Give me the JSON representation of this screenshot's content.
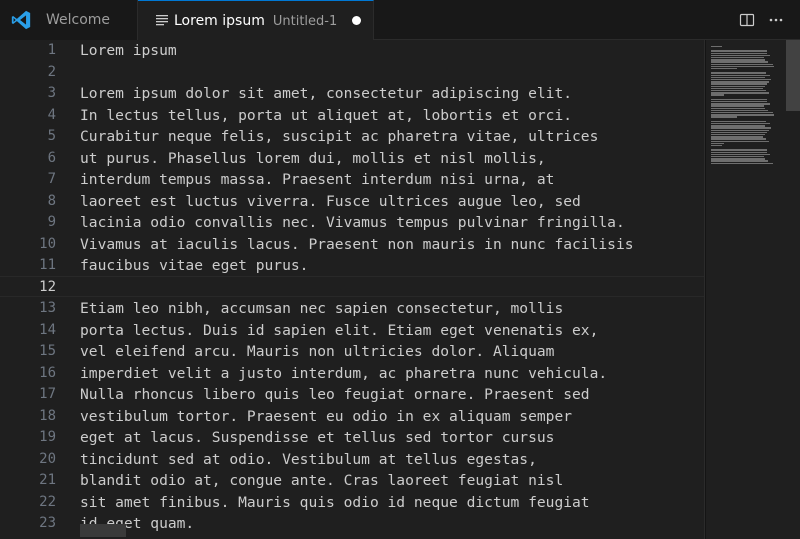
{
  "tabs": [
    {
      "label": "Welcome"
    },
    {
      "label": "Lorem ipsum",
      "description": "Untitled-1",
      "dirty": true
    }
  ],
  "editor": {
    "active_line": 12,
    "lines": [
      "Lorem ipsum",
      "",
      "Lorem ipsum dolor sit amet, consectetur adipiscing elit.",
      "In lectus tellus, porta ut aliquet at, lobortis et orci.",
      "Curabitur neque felis, suscipit ac pharetra vitae, ultrices",
      "ut purus. Phasellus lorem dui, mollis et nisl mollis,",
      "interdum tempus massa. Praesent interdum nisi urna, at",
      "laoreet est luctus viverra. Fusce ultrices augue leo, sed",
      "lacinia odio convallis nec. Vivamus tempus pulvinar fringilla.",
      "Vivamus at iaculis lacus. Praesent non mauris in nunc facilisis",
      "faucibus vitae eget purus.",
      "",
      "Etiam leo nibh, accumsan nec sapien consectetur, mollis",
      "porta lectus. Duis id sapien elit. Etiam eget venenatis ex,",
      "vel eleifend arcu. Mauris non ultricies dolor. Aliquam",
      "imperdiet velit a justo interdum, ac pharetra nunc vehicula.",
      "Nulla rhoncus libero quis leo feugiat ornare. Praesent sed",
      "vestibulum tortor. Praesent eu odio in ex aliquam semper",
      "eget at lacus. Suspendisse et tellus sed tortor cursus",
      "tincidunt sed at odio. Vestibulum at tellus egestas,",
      "blandit odio at, congue ante. Cras laoreet feugiat nisl",
      "sit amet finibus. Mauris quis odio id neque dictum feugiat",
      "id eget quam."
    ]
  },
  "colors": {
    "accent": "#0078d4",
    "background": "#1f1f1f",
    "tabbar": "#181818",
    "text": "#cccccc",
    "line_number": "#6e7681"
  },
  "icons": {
    "app": "vscode-logo-icon",
    "file": "text-file-icon",
    "split": "split-editor-icon",
    "more": "more-actions-icon"
  }
}
